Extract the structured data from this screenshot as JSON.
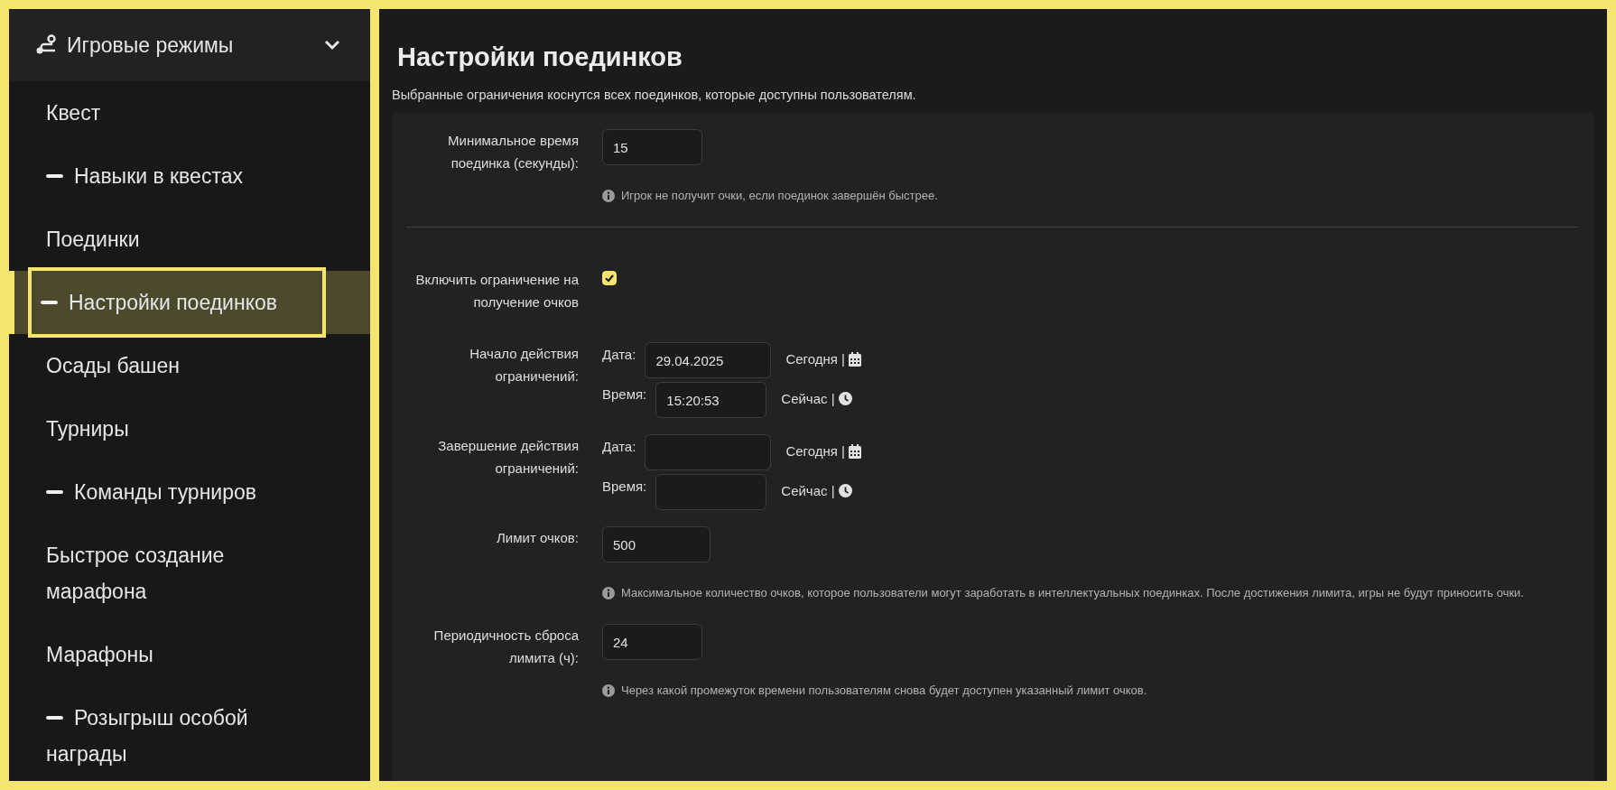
{
  "sidebar": {
    "header": {
      "label": "Игровые режимы",
      "expanded": true
    },
    "items": [
      {
        "label": "Квест",
        "kind": "top",
        "selected": false
      },
      {
        "label": "Навыки в квестах",
        "kind": "sub",
        "selected": false
      },
      {
        "label": "Поединки",
        "kind": "top",
        "selected": false
      },
      {
        "label": "Настройки поединков",
        "kind": "sub",
        "selected": true
      },
      {
        "label": "Осады башен",
        "kind": "top",
        "selected": false
      },
      {
        "label": "Турниры",
        "kind": "top",
        "selected": false
      },
      {
        "label": "Команды турниров",
        "kind": "sub",
        "selected": false
      },
      {
        "label": "Быстрое создание марафона",
        "kind": "top",
        "selected": false
      },
      {
        "label": "Марафоны",
        "kind": "top",
        "selected": false
      },
      {
        "label": "Розыгрыш особой награды",
        "kind": "sub",
        "selected": false
      }
    ]
  },
  "page": {
    "title": "Настройки поединков",
    "subtitle": "Выбранные ограничения коснутся всех поединков, которые доступны пользователям."
  },
  "form": {
    "rows": [
      {
        "kind": "input",
        "label": "Минимальное время поединка (секунды):",
        "value": "15",
        "hint": "Игрок не получит очки, если поединок завершён быстрее."
      },
      {
        "kind": "divider"
      },
      {
        "kind": "checkbox",
        "label": "Включить ограничение на получение очков",
        "checked": true
      },
      {
        "kind": "datetime",
        "label": "Начало действия ограничений:",
        "date_label": "Дата:",
        "date_value": "29.04.2025",
        "date_link": "Сегодня |",
        "time_label": "Время:",
        "time_value": "15:20:53",
        "time_link": "Сейчас |"
      },
      {
        "kind": "datetime",
        "label": "Завершение действия ограничений:",
        "date_label": "Дата:",
        "date_link": "Сегодня |",
        "time_label": "Время:",
        "time_link": "Сейчас |"
      },
      {
        "kind": "input",
        "label": "Лимит очков:",
        "value": "500",
        "hint": "Максимальное количество очков, которое пользователи могут заработать в интеллектуальных поединках. После достижения лимита, игры не будут приносить очки."
      },
      {
        "kind": "input",
        "label": "Периодичность сброса лимита (ч):",
        "value": "24",
        "hint": "Через какой промежуток времени пользователям снова будет доступен указанный лимит очков."
      }
    ]
  }
}
